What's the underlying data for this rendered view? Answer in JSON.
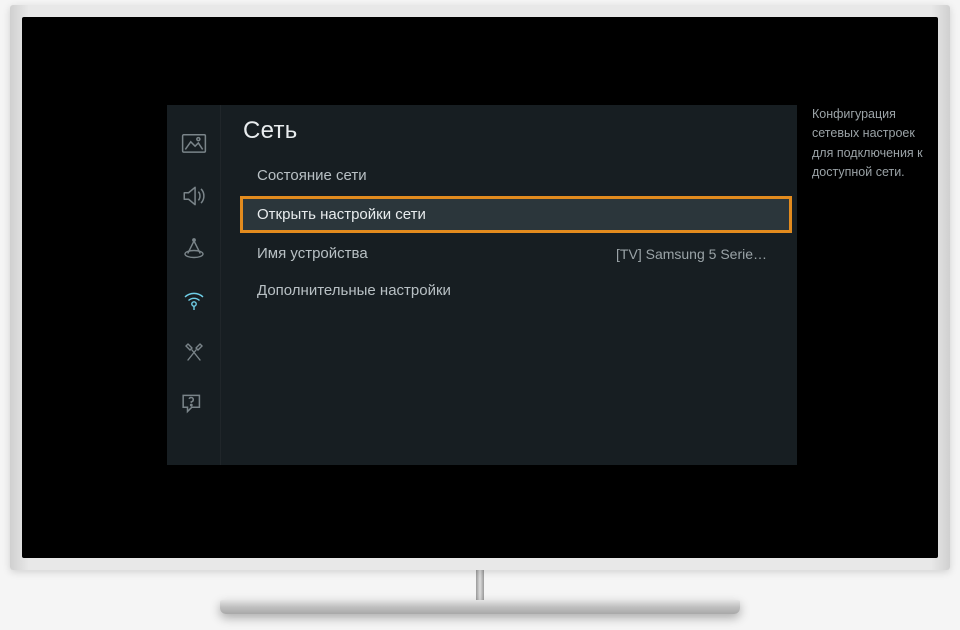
{
  "section": {
    "title": "Сеть"
  },
  "menu": {
    "items": [
      {
        "label": "Состояние сети",
        "value": ""
      },
      {
        "label": "Открыть настройки сети",
        "value": ""
      },
      {
        "label": "Имя устройства",
        "value": "[TV] Samsung 5 Serie…"
      },
      {
        "label": "Дополнительные настройки",
        "value": ""
      }
    ]
  },
  "description": "Конфигурация сетевых настроек для подключения к доступной сети.",
  "rail_icons": [
    "picture-icon",
    "sound-icon",
    "broadcast-icon",
    "network-icon",
    "system-icon",
    "support-icon"
  ]
}
